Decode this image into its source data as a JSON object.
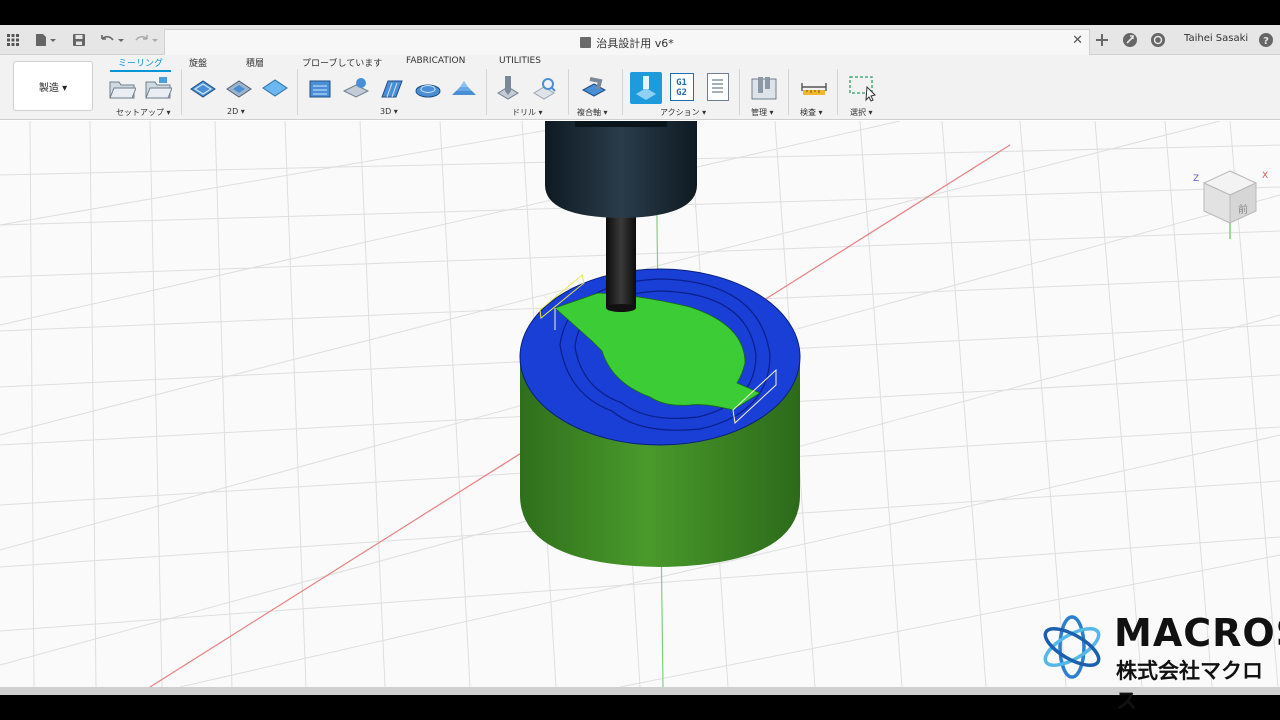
{
  "window": {
    "document_title": "治具設計用 v6*",
    "user_name": "Taihei Sasaki"
  },
  "ribbon": {
    "workspace_label": "製造 ▾",
    "tabs": [
      {
        "label": "ミーリング",
        "active": true
      },
      {
        "label": "旋盤",
        "active": false
      },
      {
        "label": "積層",
        "active": false
      },
      {
        "label": "プローブしています",
        "active": false
      },
      {
        "label": "FABRICATION",
        "active": false
      },
      {
        "label": "UTILITIES",
        "active": false
      }
    ],
    "groups": {
      "setup": "セットアップ ▾",
      "two_d": "2D ▾",
      "three_d": "3D ▾",
      "drill": "ドリル ▾",
      "multi_axis": "複合軸 ▾",
      "actions": "アクション ▾",
      "manage": "管理 ▾",
      "inspect": "検査 ▾",
      "select": "選択 ▾"
    },
    "g1g2_icon_text": "G1\nG2"
  },
  "view_cube": {
    "axis_z": "Z",
    "axis_x": "X",
    "face_label": "前"
  },
  "logo": {
    "title": "MACROS",
    "subtitle": "株式会社マクロス"
  },
  "colors": {
    "accent": "#0696d7",
    "stock_side": "#3f8a25",
    "stock_top": "#1a3fd6",
    "part_face": "#3ccc36",
    "tool_body": "#1b2a36",
    "axis_red": "#e88080",
    "axis_green": "#80d080"
  }
}
